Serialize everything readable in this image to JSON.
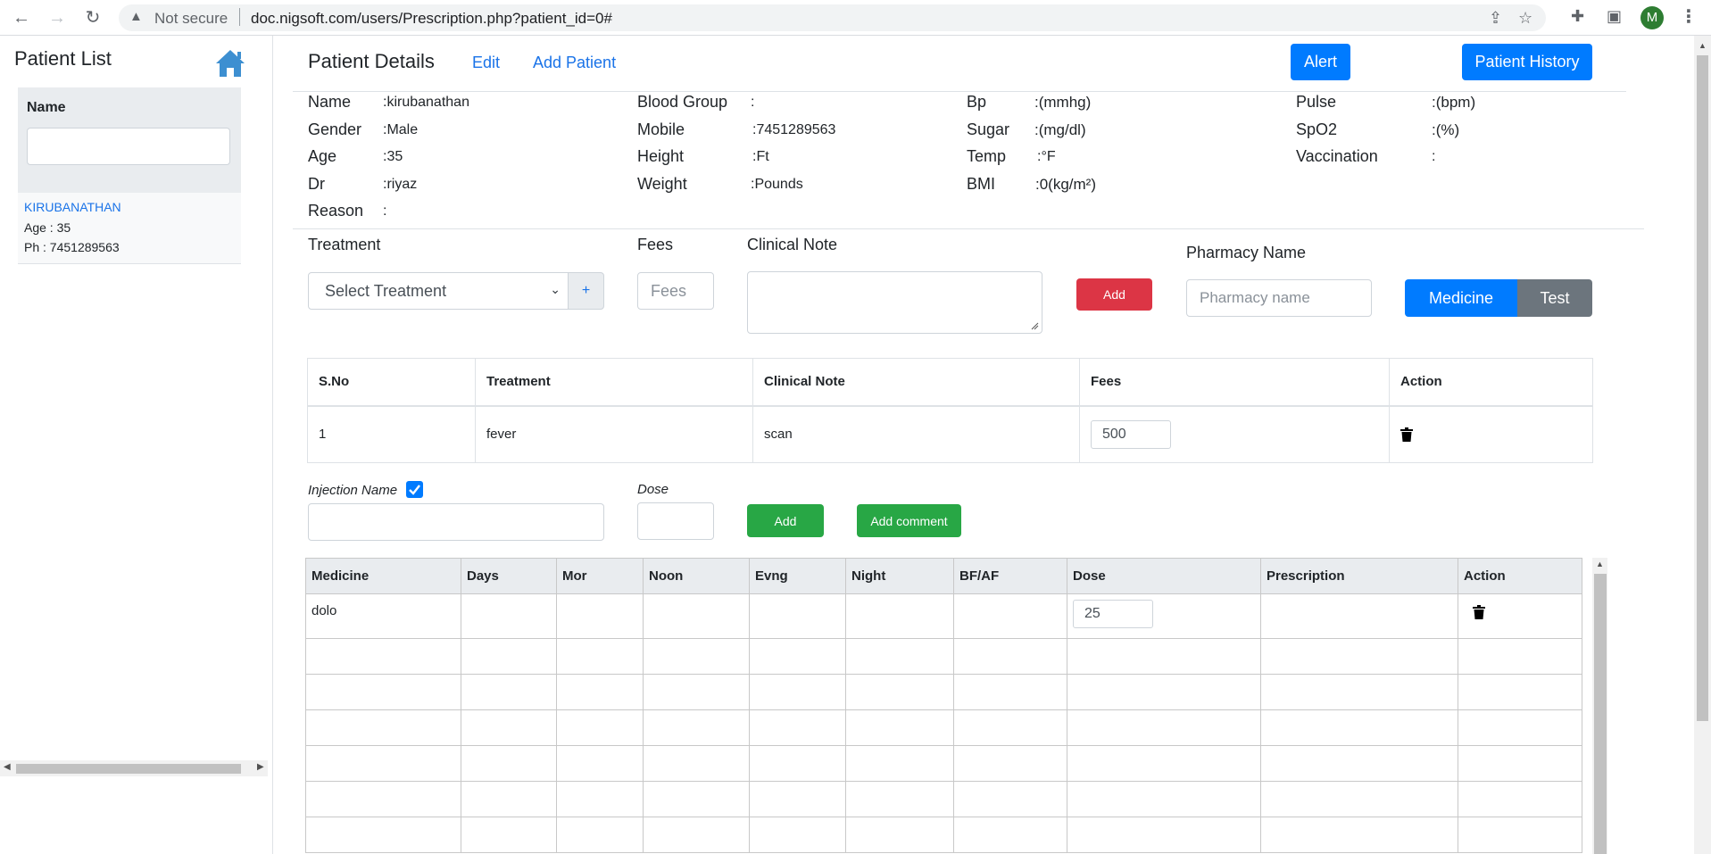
{
  "browser": {
    "not_secure": "Not secure",
    "url": "doc.nigsoft.com/users/Prescription.php?patient_id=0#",
    "profile_initial": "M"
  },
  "sidebar": {
    "title": "Patient List",
    "name_label": "Name",
    "search_value": "",
    "patient": {
      "name": "KIRUBANATHAN",
      "age": "Age : 35",
      "phone": "Ph   : 7451289563"
    }
  },
  "header": {
    "title": "Patient Details",
    "edit": "Edit",
    "add_patient": "Add Patient",
    "alert": "Alert",
    "patient_history": "Patient History"
  },
  "details": {
    "col1": [
      {
        "label": "Name",
        "value": ":kirubanathan"
      },
      {
        "label": "Gender",
        "value": ":Male"
      },
      {
        "label": "Age",
        "value": ":35"
      },
      {
        "label": "Dr",
        "value": ":riyaz"
      },
      {
        "label": "Reason",
        "value": ":"
      }
    ],
    "col2": [
      {
        "label": "Blood Group",
        "value": ":"
      },
      {
        "label": "Mobile",
        "value": ":7451289563"
      },
      {
        "label": "Height",
        "value": ":Ft"
      },
      {
        "label": "Weight",
        "value": ":Pounds"
      }
    ],
    "col3": [
      {
        "label": "Bp",
        "value": ":(mmhg)"
      },
      {
        "label": "Sugar",
        "value": ":(mg/dl)"
      },
      {
        "label": "Temp",
        "value": ":°F"
      },
      {
        "label": "BMI",
        "value": ":0(kg/m²)"
      }
    ],
    "col4": [
      {
        "label": "Pulse",
        "value": ":(bpm)"
      },
      {
        "label": "SpO2",
        "value": ":(%)"
      },
      {
        "label": "Vaccination",
        "value": ":"
      }
    ]
  },
  "form": {
    "treatment_label": "Treatment",
    "treatment_select": "Select Treatment",
    "plus": "+",
    "fees_label": "Fees",
    "fees_placeholder": "Fees",
    "clinical_label": "Clinical Note",
    "add": "Add",
    "pharmacy_label": "Pharmacy Name",
    "pharmacy_placeholder": "Pharmacy name",
    "medicine_tab": "Medicine",
    "test_tab": "Test"
  },
  "treatment_table": {
    "headers": [
      "S.No",
      "Treatment",
      "Clinical Note",
      "Fees",
      "Action"
    ],
    "rows": [
      {
        "sno": "1",
        "treatment": "fever",
        "note": "scan",
        "fees": "500"
      }
    ]
  },
  "injection": {
    "label": "Injection Name",
    "checked": true,
    "dose_label": "Dose",
    "add": "Add",
    "add_comment": "Add comment"
  },
  "medicine_table": {
    "headers": [
      "Medicine",
      "Days",
      "Mor",
      "Noon",
      "Evng",
      "Night",
      "BF/AF",
      "Dose",
      "Prescription",
      "Action"
    ],
    "rows": [
      {
        "medicine": "dolo",
        "dose": "25"
      }
    ]
  },
  "colors": {
    "primary": "#007bff",
    "danger": "#dc3545",
    "success": "#28a745",
    "secondary": "#6c757d",
    "link": "#1a73e8"
  }
}
